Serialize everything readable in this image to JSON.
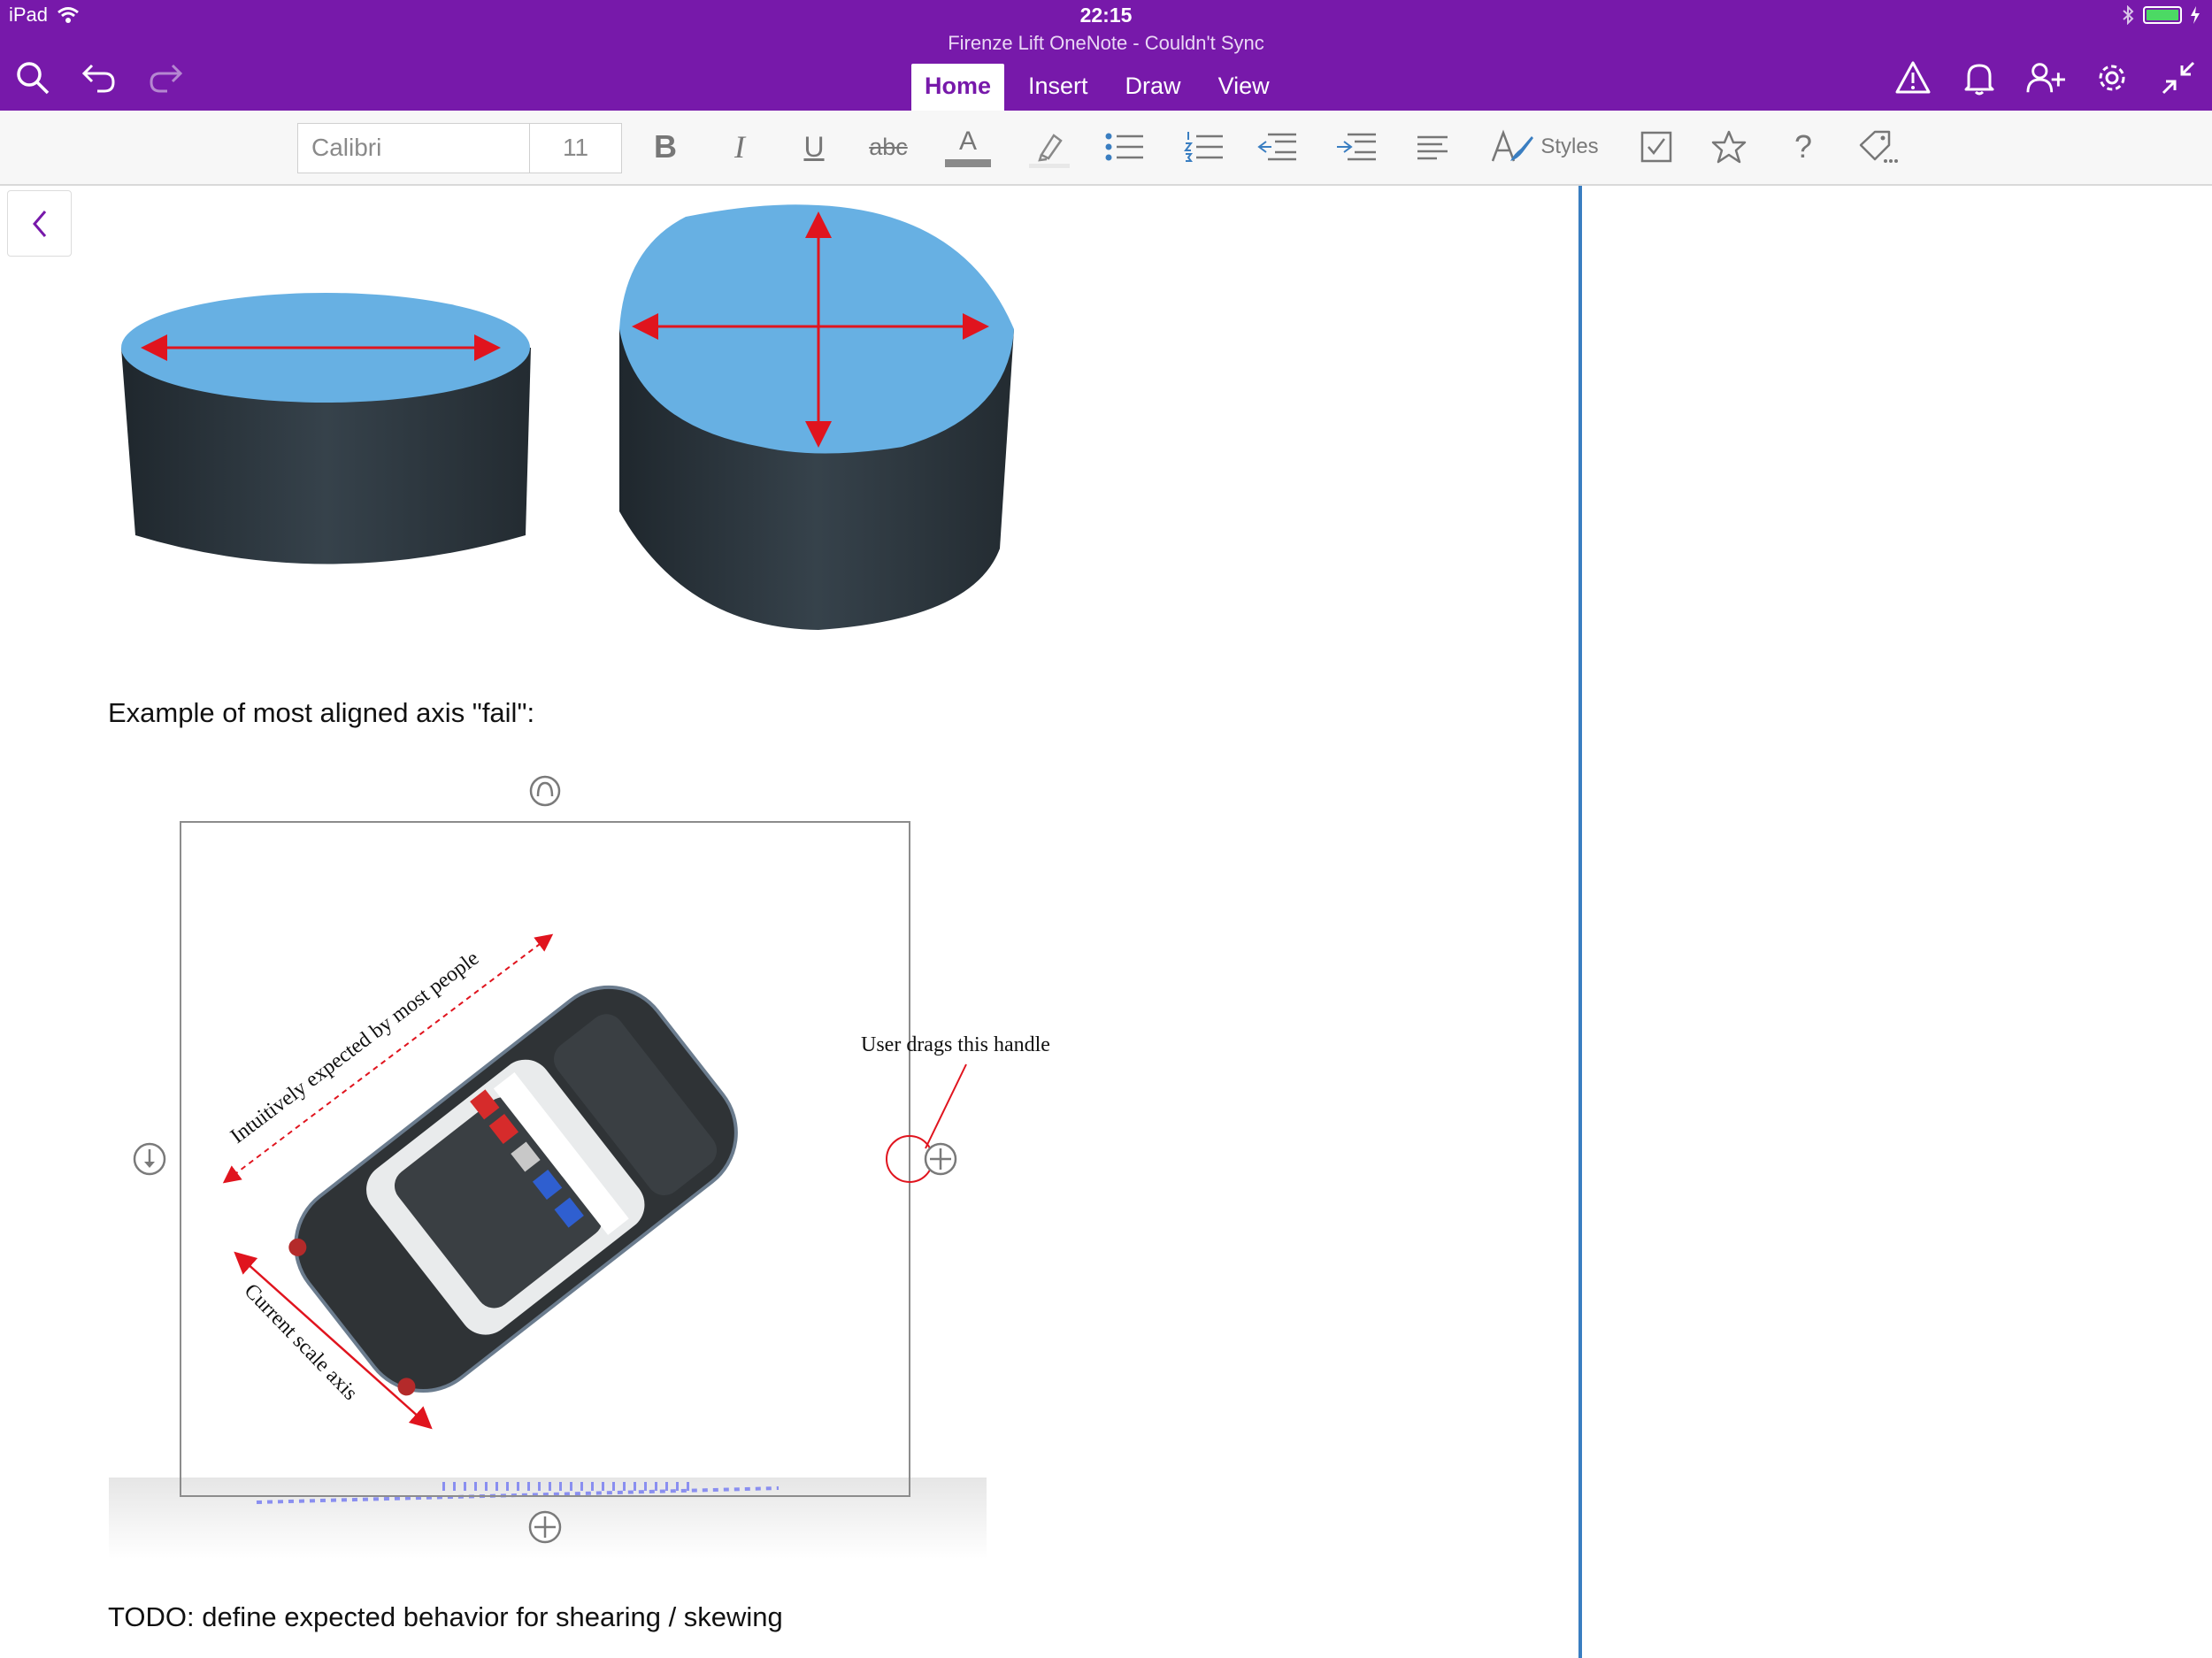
{
  "status_bar": {
    "device": "iPad",
    "time": "22:15"
  },
  "window": {
    "title": "Firenze Lift OneNote - Couldn't Sync"
  },
  "toolbar": {
    "left_icons": [
      "search-icon",
      "undo-icon",
      "redo-icon"
    ],
    "right_icons": [
      "warning-icon",
      "bell-icon",
      "add-person-icon",
      "gear-icon",
      "collapse-icon"
    ]
  },
  "tabs": [
    {
      "label": "Home",
      "active": true
    },
    {
      "label": "Insert",
      "active": false
    },
    {
      "label": "Draw",
      "active": false
    },
    {
      "label": "View",
      "active": false
    }
  ],
  "ribbon": {
    "font_name": "Calibri",
    "font_size": "11",
    "bold": "B",
    "italic": "I",
    "underline": "U",
    "strikethrough": "abc",
    "font_color": "A",
    "styles_label": "Styles",
    "help": "?",
    "icons": [
      "bold-icon",
      "italic-icon",
      "underline-icon",
      "strikethrough-icon",
      "font-color-icon",
      "highlighter-icon",
      "bullet-list-icon",
      "numbered-list-icon",
      "outdent-icon",
      "indent-icon",
      "align-icon",
      "styles-icon",
      "todo-checkbox-icon",
      "star-icon",
      "help-icon",
      "tag-icon"
    ]
  },
  "page": {
    "caption_fail": "Example of most aligned axis \"fail\":",
    "caption_todo": "TODO: define expected behavior for shearing / skewing",
    "annotations": {
      "intuitive_axis": "Intuitively expected by most people",
      "current_axis": "Current scale axis",
      "handle_note": "User drags this handle"
    }
  },
  "colors": {
    "app_purple": "#7719aa",
    "cylinder_top": "#67b0e3",
    "cylinder_body": "#2f3941",
    "arrow_red": "#e0141e",
    "divider_blue": "#3a7ec1"
  }
}
